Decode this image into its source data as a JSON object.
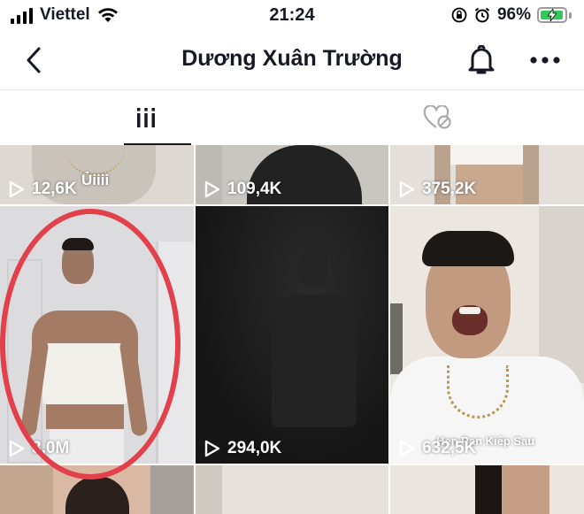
{
  "status_bar": {
    "carrier": "Viettel",
    "time": "21:24",
    "battery_percent": "96%",
    "battery_level": 0.96
  },
  "header": {
    "title": "Dương Xuân Trường"
  },
  "tabs": [
    {
      "icon": "grid-icon",
      "active": true
    },
    {
      "icon": "liked-hidden-icon",
      "active": false
    }
  ],
  "videos": [
    {
      "views": "12,6K",
      "caption": "Ủiiii"
    },
    {
      "views": "109,4K"
    },
    {
      "views": "375,2K"
    },
    {
      "views": "8,0M"
    },
    {
      "views": "294,0K"
    },
    {
      "views": "632,5K",
      "caption": "Hẹn Pạn Kiếp Sau"
    }
  ],
  "colors": {
    "highlight_circle": "#e2404a",
    "battery": "#34c759",
    "text": "#161823"
  }
}
